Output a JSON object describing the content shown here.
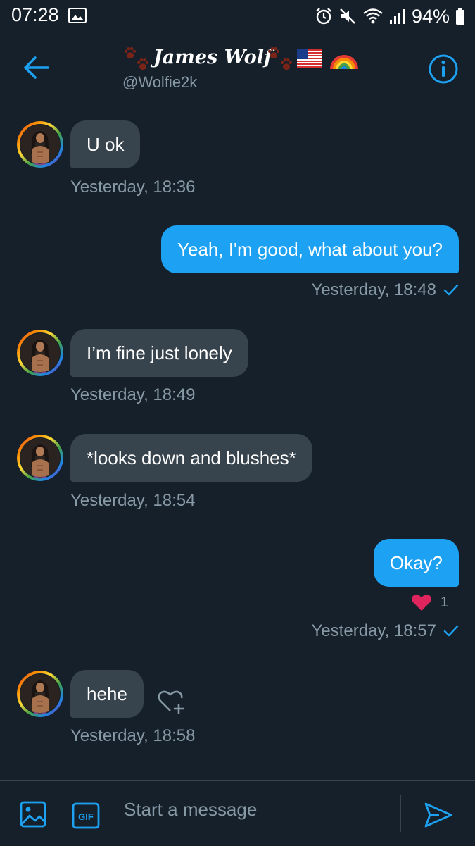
{
  "status_bar": {
    "time": "07:28",
    "battery": "94%",
    "icons": [
      "gallery-icon",
      "alarm-icon",
      "mute-icon",
      "wifi-icon",
      "signal-icon",
      "battery-icon"
    ]
  },
  "header": {
    "name": "James Wolf",
    "handle": "@Wolfie2k",
    "icons": [
      "back-arrow-icon",
      "paw-icon",
      "us-flag-icon",
      "rainbow-icon",
      "info-icon"
    ]
  },
  "messages": [
    {
      "from": "them",
      "text": "U ok",
      "time": "Yesterday, 18:36"
    },
    {
      "from": "me",
      "text": "Yeah, I'm good, what about you?",
      "time": "Yesterday, 18:48"
    },
    {
      "from": "them",
      "text": "I’m fine just lonely",
      "time": "Yesterday, 18:49"
    },
    {
      "from": "them",
      "text": "*looks down and blushes*",
      "time": "Yesterday, 18:54"
    },
    {
      "from": "me",
      "text": "Okay?",
      "time": "Yesterday, 18:57",
      "reaction": {
        "icon": "heart-icon",
        "count": "1"
      }
    },
    {
      "from": "them",
      "text": "hehe",
      "time": "Yesterday, 18:58"
    }
  ],
  "composer": {
    "placeholder": "Start a message",
    "gif_label": "GIF"
  },
  "colors": {
    "background": "#15202b",
    "accent": "#1da1f2",
    "incoming_bubble": "#38444d",
    "muted_text": "#8899a6",
    "heart": "#e0245e"
  }
}
